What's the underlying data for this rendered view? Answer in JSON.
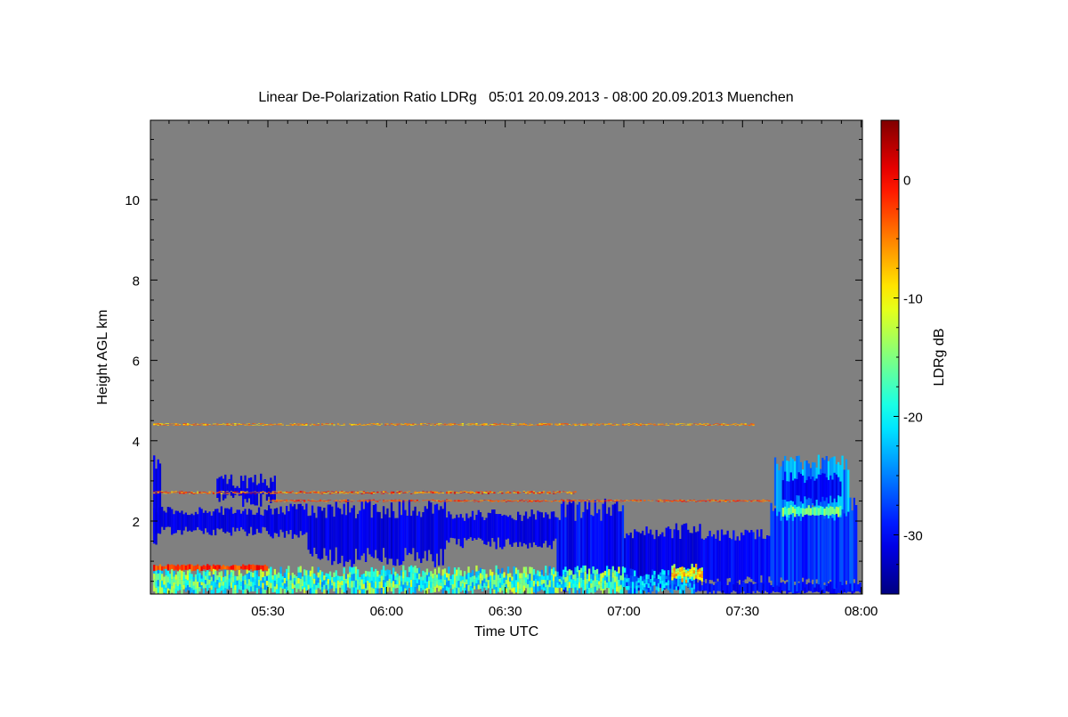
{
  "chart_data": {
    "type": "heatmap",
    "title": "Linear De-Polarization Ratio LDRg   05:01 20.09.2013 - 08:00 20.09.2013 Muenchen",
    "xlabel": "Time UTC",
    "ylabel": "Height AGL km",
    "colorbar_label": "LDRg dB",
    "x_unit": "minutes after 05:00 UTC",
    "xlim": [
      1,
      180
    ],
    "ylim": [
      0.18,
      12
    ],
    "clim": [
      -35,
      5
    ],
    "colormap": "jet",
    "missing_color": "#808080",
    "x_ticks": [
      {
        "value": 30,
        "label": "05:30"
      },
      {
        "value": 60,
        "label": "06:00"
      },
      {
        "value": 90,
        "label": "06:30"
      },
      {
        "value": 120,
        "label": "07:00"
      },
      {
        "value": 150,
        "label": "07:30"
      },
      {
        "value": 180,
        "label": "08:00"
      }
    ],
    "y_ticks": [
      {
        "value": 2,
        "label": "2"
      },
      {
        "value": 4,
        "label": "4"
      },
      {
        "value": 6,
        "label": "6"
      },
      {
        "value": 8,
        "label": "8"
      },
      {
        "value": 10,
        "label": "10"
      }
    ],
    "colorbar_ticks": [
      {
        "value": 0,
        "label": "0"
      },
      {
        "value": -10,
        "label": "-10"
      },
      {
        "value": -20,
        "label": "-20"
      },
      {
        "value": -30,
        "label": "-30"
      }
    ],
    "regions": [
      {
        "t0": 1,
        "t1": 3,
        "h0": 1.6,
        "h1": 3.5,
        "v": -31,
        "jit": 0.2,
        "dv": 1
      },
      {
        "t0": 1,
        "t1": 30,
        "h0": 1.75,
        "h1": 2.25,
        "v": -31,
        "jit": 0.12,
        "dv": 1
      },
      {
        "t0": 17,
        "t1": 32,
        "h0": 2.55,
        "h1": 3.0,
        "v": -31,
        "jit": 0.2,
        "dv": 1
      },
      {
        "t0": 30,
        "t1": 40,
        "h0": 1.7,
        "h1": 2.3,
        "v": -31,
        "jit": 0.15,
        "dv": 1
      },
      {
        "t0": 40,
        "t1": 75,
        "h0": 1.1,
        "h1": 2.3,
        "v": -31,
        "jit": 0.25,
        "dv": 1.5
      },
      {
        "t0": 75,
        "t1": 103,
        "h0": 1.45,
        "h1": 2.15,
        "v": -31,
        "jit": 0.15,
        "dv": 1
      },
      {
        "t0": 103,
        "t1": 120,
        "h0": 0.5,
        "h1": 2.3,
        "v": -30,
        "jit": 0.3,
        "dv": 2
      },
      {
        "t0": 120,
        "t1": 140,
        "h0": 0.45,
        "h1": 1.75,
        "v": -31,
        "jit": 0.2,
        "dv": 1.5
      },
      {
        "t0": 140,
        "t1": 157,
        "h0": 0.5,
        "h1": 1.65,
        "v": -30,
        "jit": 0.15,
        "dv": 1.5
      },
      {
        "t0": 138,
        "t1": 180,
        "h0": 0.22,
        "h1": 0.45,
        "v": -30,
        "jit": 0.05,
        "dv": 1.5
      },
      {
        "t0": 157,
        "t1": 179,
        "h0": 0.4,
        "h1": 2.4,
        "v": -28,
        "jit": 0.2,
        "dv": 2
      },
      {
        "t0": 158,
        "t1": 177,
        "h0": 2.2,
        "h1": 3.45,
        "v": -24,
        "jit": 0.2,
        "dv": 3
      },
      {
        "t0": 160,
        "t1": 175,
        "h0": 2.5,
        "h1": 3.1,
        "v": -30,
        "jit": 0.15,
        "dv": 1.5
      },
      {
        "t0": 160,
        "t1": 175,
        "h0": 2.15,
        "h1": 2.35,
        "v": -16,
        "jit": 0.05,
        "dv": 3
      },
      {
        "t0": 1,
        "t1": 120,
        "h0": 0.2,
        "h1": 0.75,
        "v": -18,
        "jit": 0.15,
        "dv": 7
      },
      {
        "t0": 120,
        "t1": 138,
        "h0": 0.25,
        "h1": 0.7,
        "v": -24,
        "jit": 0.15,
        "dv": 5
      },
      {
        "t0": 132,
        "t1": 140,
        "h0": 0.55,
        "h1": 0.85,
        "v": -10,
        "jit": 0.1,
        "dv": 5
      },
      {
        "t0": 1,
        "t1": 30,
        "h0": 0.78,
        "h1": 0.9,
        "v": -2,
        "jit": 0.03,
        "dv": 3
      },
      {
        "t0": 1,
        "t1": 108,
        "h0": 2.68,
        "h1": 2.74,
        "v": -4,
        "jit": 0.01,
        "dv": 6
      },
      {
        "t0": 30,
        "t1": 157,
        "h0": 2.48,
        "h1": 2.53,
        "v": -3,
        "jit": 0.01,
        "dv": 4
      },
      {
        "t0": 1,
        "t1": 153,
        "h0": 4.38,
        "h1": 4.43,
        "v": -6,
        "jit": 0.01,
        "dv": 4
      }
    ]
  }
}
